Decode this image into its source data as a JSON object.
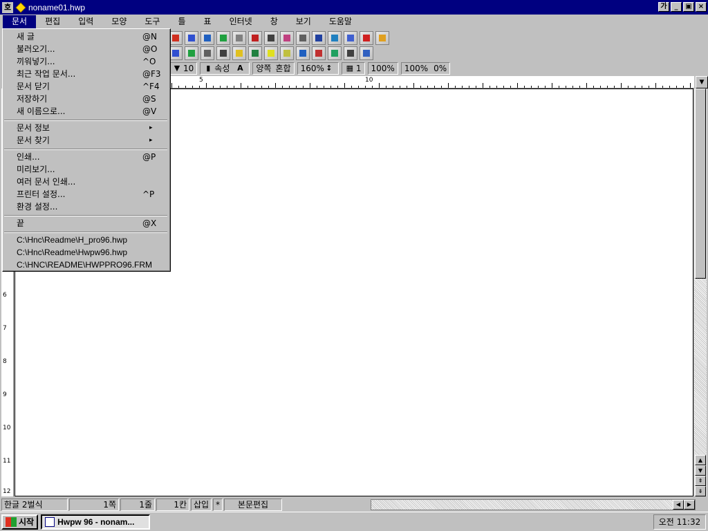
{
  "window": {
    "app_icon": "hangul-app-icon",
    "doc_icon": "pencil-doc-icon",
    "title": "noname01.hwp",
    "controls": {
      "ime": "가",
      "minimize": "_",
      "restore": "▣",
      "close": "×"
    }
  },
  "menubar": [
    {
      "label": "문서",
      "active": true
    },
    {
      "label": "편집"
    },
    {
      "label": "입력"
    },
    {
      "label": "모양"
    },
    {
      "label": "도구"
    },
    {
      "label": "틀"
    },
    {
      "label": "표"
    },
    {
      "label": "인터넷"
    },
    {
      "label": "창"
    },
    {
      "label": "보기"
    },
    {
      "label": "도움말"
    }
  ],
  "format_bar": {
    "font_size": "10",
    "attribute_label": "속성",
    "align": "양쪽",
    "mix": "혼합",
    "line_spacing": "160%",
    "columns": "1",
    "zoom1": "100%",
    "zoom2": "100%",
    "percent3": "0%"
  },
  "ruler": {
    "labels": [
      "5",
      "10"
    ]
  },
  "vruler": {
    "labels": [
      "6",
      "7",
      "8",
      "9",
      "10",
      "11",
      "12"
    ]
  },
  "doc_menu": {
    "items": [
      {
        "label": "새 글",
        "shortcut": "@N"
      },
      {
        "label": "불러오기...",
        "shortcut": "@O"
      },
      {
        "label": "끼워넣기...",
        "shortcut": "^O"
      },
      {
        "label": "최근 작업 문서...",
        "shortcut": "@F3"
      },
      {
        "label": "문서 닫기",
        "shortcut": "^F4"
      },
      {
        "label": "저장하기",
        "shortcut": "@S"
      },
      {
        "label": "새 이름으로...",
        "shortcut": "@V"
      },
      {
        "label": "문서 정보",
        "shortcut": "▸"
      },
      {
        "label": "문서 찾기",
        "shortcut": "▸"
      },
      {
        "label": "인쇄...",
        "shortcut": "@P"
      },
      {
        "label": "미리보기...",
        "shortcut": ""
      },
      {
        "label": "여러 문서 인쇄...",
        "shortcut": ""
      },
      {
        "label": "프린터 설정...",
        "shortcut": "^P"
      },
      {
        "label": "환경 설정...",
        "shortcut": ""
      },
      {
        "label": "끝",
        "shortcut": "@X"
      }
    ],
    "recent_files": [
      "C:\\Hnc\\Readme\\H_pro96.hwp",
      "C:\\Hnc\\Readme\\Hwpw96.hwp",
      "C:\\HNC\\README\\HWPPRO96.FRM"
    ]
  },
  "statusbar": {
    "input_mode": "한글 2벌식",
    "page": "1쪽",
    "line": "1줄",
    "column": "1칸",
    "insert": "삽입",
    "modified": "*",
    "mode": "본문편집"
  },
  "taskbar": {
    "start_label": "시작",
    "task_label": "Hwpw 96 - nonam...",
    "clock": "오전 11:32"
  }
}
